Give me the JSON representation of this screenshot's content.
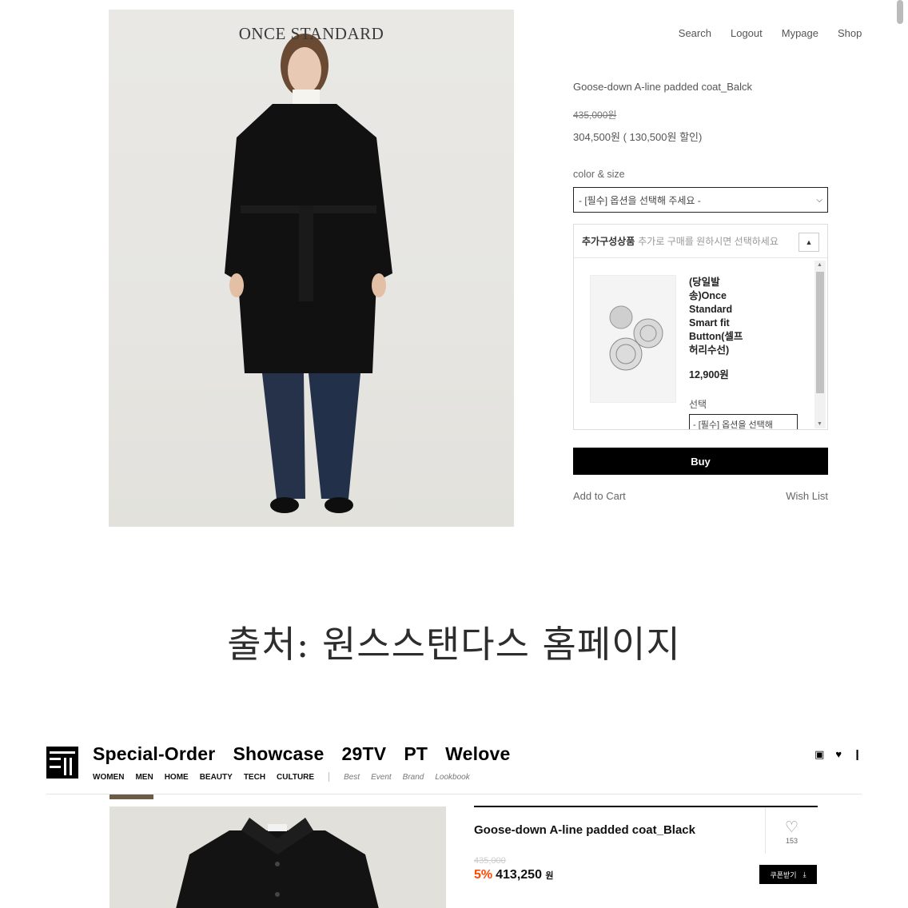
{
  "brand_site": {
    "photo_logo": "ONCE STANDARD",
    "nav": [
      "Search",
      "Logout",
      "Mypage",
      "Shop"
    ],
    "product_name": "Goose-down A-line padded coat_Balck",
    "original_price": "435,000원",
    "sale_price": "304,500원 ( 130,500원 할인)",
    "option_label": "color & size",
    "option_select": "- [필수] 옵션을 선택해 주세요 -",
    "addon": {
      "title": "추가구성상품",
      "subtitle": "추가로 구매를 원하시면 선택하세요",
      "item_name": "(당일발송)Once Standard Smart fit Button(셀프허리수선)",
      "item_price": "12,900원",
      "select_label": "선택",
      "select_value": "- [필수] 옵션을 선택해"
    },
    "buy": "Buy",
    "add_to_cart": "Add to Cart",
    "wish_list": "Wish List"
  },
  "caption": "출처: 원스스탠다스 홈페이지",
  "shop_site": {
    "main_nav": [
      "Special-Order",
      "Showcase",
      "29TV",
      "PT",
      "Welove"
    ],
    "sub_nav": [
      "WOMEN",
      "MEN",
      "HOME",
      "BEAUTY",
      "TECH",
      "CULTURE"
    ],
    "sub_nav_italic": [
      "Best",
      "Event",
      "Brand",
      "Lookbook"
    ],
    "product_name": "Goose-down A-line padded coat_Black",
    "like_count": "153",
    "original_price": "435,000",
    "discount_rate": "5%",
    "price": "413,250",
    "won": "원",
    "coupon": "쿠폰받기"
  },
  "icons": [
    "bag-icon",
    "heart-icon",
    "download-icon",
    "chevron-down-icon",
    "chevron-up-icon"
  ]
}
